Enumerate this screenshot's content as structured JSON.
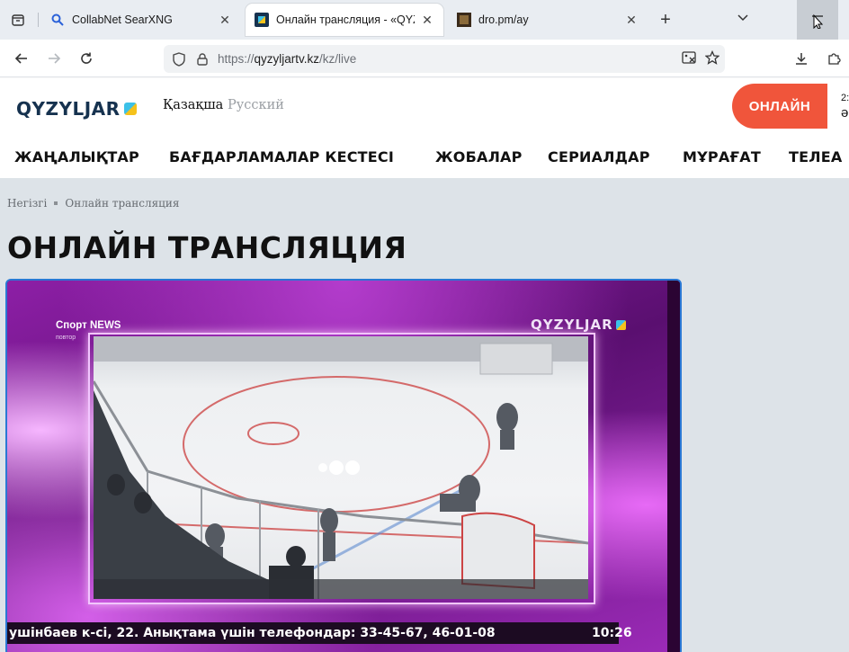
{
  "browser": {
    "tabs": [
      {
        "title": "CollabNet SearXNG",
        "favicon": "search-icon",
        "active": false
      },
      {
        "title": "Онлайн трансляция - «QYZYL",
        "favicon": "qyzyljar-favicon",
        "active": true
      },
      {
        "title": "dro.pm/ay",
        "favicon": "dro-favicon",
        "active": false
      }
    ],
    "new_tab_symbol": "+",
    "url_protocol": "https://",
    "url_domain": "qyzyljartv.kz",
    "url_path": "/kz/live"
  },
  "site": {
    "logo_text": "QYZYLJAR",
    "lang_kz": "Қазақша",
    "lang_ru": "Русский",
    "online_button": "ОНЛАЙН",
    "clip_top": "2:",
    "clip_bottom": "ə",
    "nav": [
      "ЖАҢАЛЫҚТАР",
      "БАҒДАРЛАМАЛАР КЕСТЕСІ",
      "ЖОБАЛАР",
      "СЕРИАЛДАР",
      "МҰРАҒАТ",
      "ТЕЛЕА"
    ]
  },
  "page": {
    "breadcrumb_home": "Негізгі",
    "breadcrumb_current": "Онлайн трансляция",
    "title": "ОНЛАЙН ТРАНСЛЯЦИЯ"
  },
  "player": {
    "show_title": "Спорт NEWS",
    "show_subtitle": "повтор",
    "channel_logo": "QYZYLJAR",
    "ticker_text": "ушінбаев к-сі, 22. Анықтама үшін телефондар: 33-45-67, 46-01-08",
    "clock": "10:26"
  },
  "colors": {
    "accent_orange": "#f0553b",
    "player_border": "#2a78d4",
    "logo_navy": "#16324f"
  }
}
